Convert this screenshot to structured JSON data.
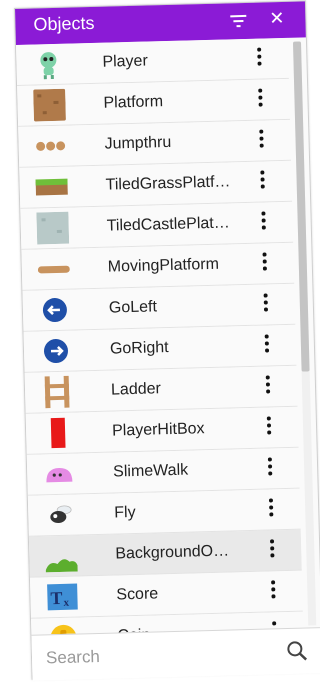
{
  "header": {
    "title": "Objects"
  },
  "objects": [
    {
      "label": "Player",
      "icon": "player-sprite-icon"
    },
    {
      "label": "Platform",
      "icon": "platform-tile-icon"
    },
    {
      "label": "Jumpthru",
      "icon": "jumpthru-icon"
    },
    {
      "label": "TiledGrassPlatf…",
      "icon": "grass-tile-icon"
    },
    {
      "label": "TiledCastlePlat…",
      "icon": "castle-tile-icon"
    },
    {
      "label": "MovingPlatform",
      "icon": "moving-platform-icon"
    },
    {
      "label": "GoLeft",
      "icon": "go-left-icon"
    },
    {
      "label": "GoRight",
      "icon": "go-right-icon"
    },
    {
      "label": "Ladder",
      "icon": "ladder-icon"
    },
    {
      "label": "PlayerHitBox",
      "icon": "hitbox-icon"
    },
    {
      "label": "SlimeWalk",
      "icon": "slime-icon"
    },
    {
      "label": "Fly",
      "icon": "fly-icon"
    },
    {
      "label": "BackgroundO…",
      "icon": "background-object-icon",
      "selected": true
    },
    {
      "label": "Score",
      "icon": "score-text-icon"
    },
    {
      "label": "Coin",
      "icon": "coin-icon"
    }
  ],
  "search": {
    "placeholder": "Search"
  },
  "colors": {
    "header": "#8b1bd6",
    "selected_row": "#e9e9e9"
  }
}
